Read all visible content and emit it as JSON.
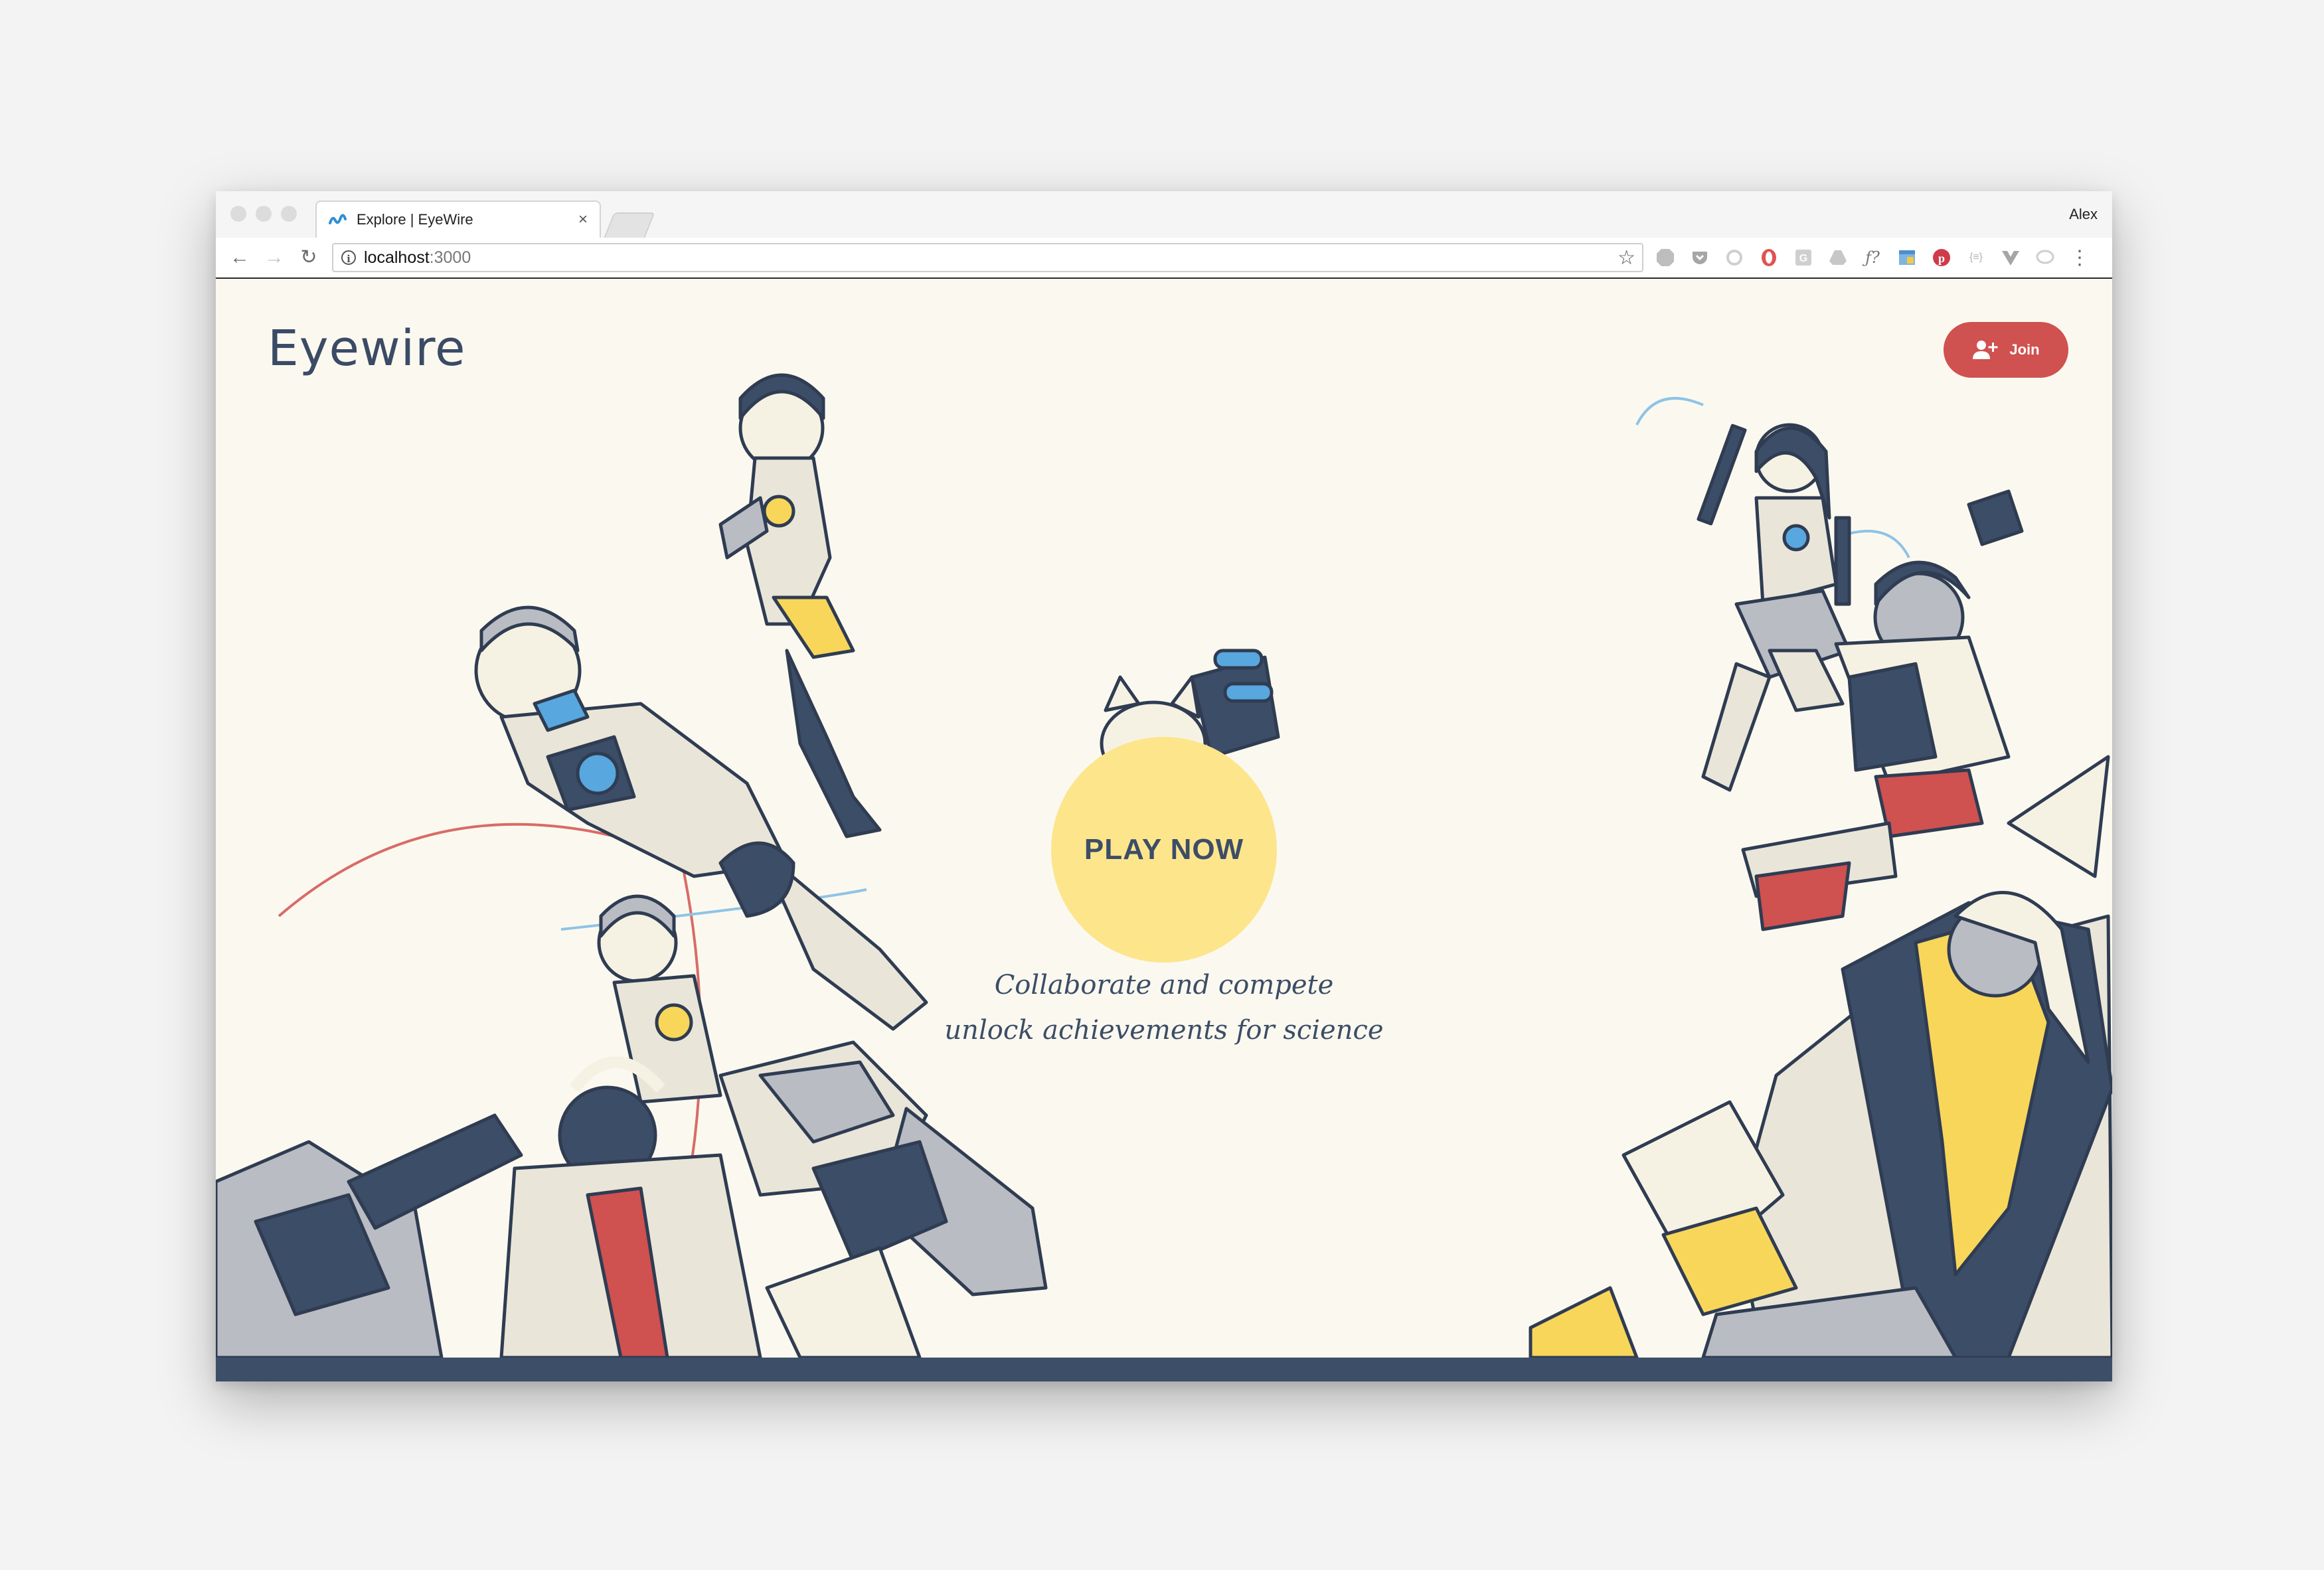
{
  "browser": {
    "tab_title": "Explore | EyeWire",
    "profile_name": "Alex",
    "url_host": "localhost",
    "url_port": ":3000",
    "extensions": [
      "abp-icon",
      "pocket-icon",
      "sync-icon",
      "opera-icon",
      "g-icon",
      "drive-icon",
      "fx-icon",
      "window-icon",
      "pinterest-icon",
      "json-icon",
      "vue-icon",
      "chat-icon"
    ]
  },
  "page": {
    "logo_text": "Eyewire",
    "join_label": "Join",
    "play_label": "PLAY NOW",
    "tagline_line1": "Collaborate and compete",
    "tagline_line2": "unlock achievements for science"
  },
  "colors": {
    "background": "#fbf9ef",
    "navy": "#3c4d67",
    "accent_red": "#cf5150",
    "accent_yellow": "#fde58c"
  }
}
